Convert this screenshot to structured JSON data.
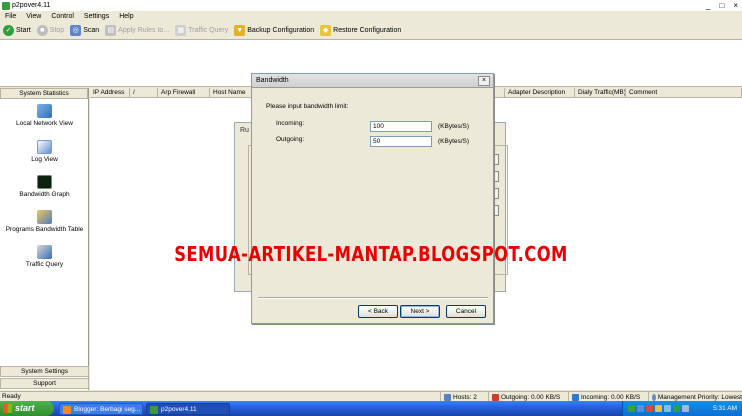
{
  "window": {
    "title": "p2pover4.11",
    "min": "_",
    "max": "□",
    "close": "×"
  },
  "menu": [
    "File",
    "View",
    "Control",
    "Settings",
    "Help"
  ],
  "toolbar": [
    {
      "label": "Start",
      "icon": "start-icon",
      "disabled": false
    },
    {
      "label": "Stop",
      "icon": "stop-icon",
      "disabled": true
    },
    {
      "label": "Scan",
      "icon": "scan-icon",
      "disabled": false
    },
    {
      "label": "Apply Rules to...",
      "icon": "apply-rules-icon",
      "disabled": true
    },
    {
      "label": "Traffic Query",
      "icon": "traffic-query-icon",
      "disabled": true
    },
    {
      "label": "Backup Configuration",
      "icon": "backup-icon",
      "disabled": false
    },
    {
      "label": "Restore Configuration",
      "icon": "restore-icon",
      "disabled": false
    }
  ],
  "left": {
    "header": "System Statistics",
    "items": [
      {
        "label": "Local Network View",
        "icon": "network-icon"
      },
      {
        "label": "Log View",
        "icon": "log-icon"
      },
      {
        "label": "Bandwidth Graph",
        "icon": "graph-icon"
      },
      {
        "label": "Programs Bandwidth Table",
        "icon": "programs-icon"
      },
      {
        "label": "Traffic Query",
        "icon": "query-icon"
      }
    ],
    "settings": "System Settings",
    "support": "Support"
  },
  "table": {
    "columns": [
      "IP Address",
      "/",
      "Arp Firewall",
      "Host Name",
      "Adapter Description",
      "Dialy Traffic(MB)",
      "Comment"
    ]
  },
  "bg_dialog": {
    "title": "Ru"
  },
  "dialog": {
    "title": "Bandwidth",
    "close": "×",
    "prompt": "Please input bandwidth limit:",
    "incoming_label": "Incoming:",
    "incoming_value": "100",
    "outgoing_label": "Outgoing:",
    "outgoing_value": "50",
    "unit": "(KBytes/S)",
    "back": "< Back",
    "next": "Next >",
    "cancel": "Cancel"
  },
  "watermark": "SEMUA-ARTIKEL-MANTAP.BLOGSPOT.COM",
  "status": {
    "ready": "Ready",
    "hosts": "Hosts: 2",
    "outgoing": "Outgoing: 0.00 KB/S",
    "incoming": "Incoming: 0.00 KB/S",
    "priority": "Management Priority: Lowest"
  },
  "taskbar": {
    "start": "start",
    "items": [
      {
        "label": "Blogger: Berbagi seg...",
        "active": false
      },
      {
        "label": "p2pover4.11",
        "active": true
      }
    ],
    "clock": "5:31 AM"
  },
  "colors": {
    "watermark": "#ea0000",
    "taskbar": "#245edb",
    "start": "#3a9f37"
  }
}
